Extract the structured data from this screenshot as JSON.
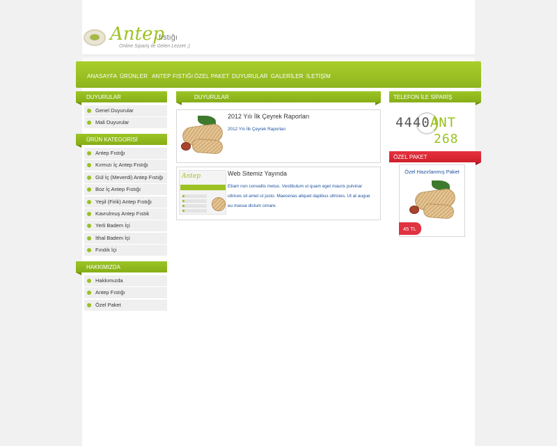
{
  "header": {
    "logo_main": "Antep",
    "logo_sub": "fıstığı",
    "slogan": "Online Sipariş ile Gelen Lezzet ;)"
  },
  "nav": [
    "ANASAYFA",
    "ÜRÜNLER",
    "ANTEP FISTIĞI",
    "ÖZEL PAKET",
    "DUYURULAR",
    "GALERİLER",
    "İLETİŞİM"
  ],
  "sidebar": {
    "announcements": {
      "title": "DUYURULAR",
      "items": [
        "Genel Duyurular",
        "Mali Duyurular"
      ]
    },
    "categories": {
      "title": "ÜRÜN KATEGORİSİ",
      "items": [
        "Antep Fıstığı",
        "Kırmızı İç Antep Fıstığı",
        "Gül İç (Meverdi) Antep Fıstığı",
        "Boz İç Antep Fıstığı",
        "Yeşil (Firik) Antep Fıstığı",
        "Kavrulmuş Antep Fıstık",
        "Yerli Badem İçi",
        "İthal Badem İçi",
        "Fındık İçi"
      ]
    },
    "about": {
      "title": "HAKKIMIZDA",
      "items": [
        "Hakkımızda",
        "Antep Fıstığı",
        "Özel Paket"
      ]
    }
  },
  "main": {
    "title": "DUYURULAR",
    "news": [
      {
        "title": "2012 Yılı İlk Çeyrek Raporları",
        "body": "2012 Yılı İlk Çeyrek Raporları"
      },
      {
        "title": "Web Sitemiz Yayında",
        "body": "Etiam non convallis metus. Vestibulum ut quam eget mauris pulvinar ultrices sit amet ut justo. Maecenas aliquet dapibus ultricies. Ut at augue eu massa dictum ornare."
      }
    ]
  },
  "right": {
    "phone_title": "TELEFON İLE SİPARİŞ",
    "phone_part1": "4440",
    "phone_part2": "ANT",
    "phone_part3": "268",
    "special_title": "ÖZEL PAKET",
    "special_name": "Özel Hazırlanmış Paket",
    "special_price": "45 TL"
  },
  "colors": {
    "accent": "#9cc224",
    "red": "#e03240",
    "link": "#1d4f9e"
  }
}
